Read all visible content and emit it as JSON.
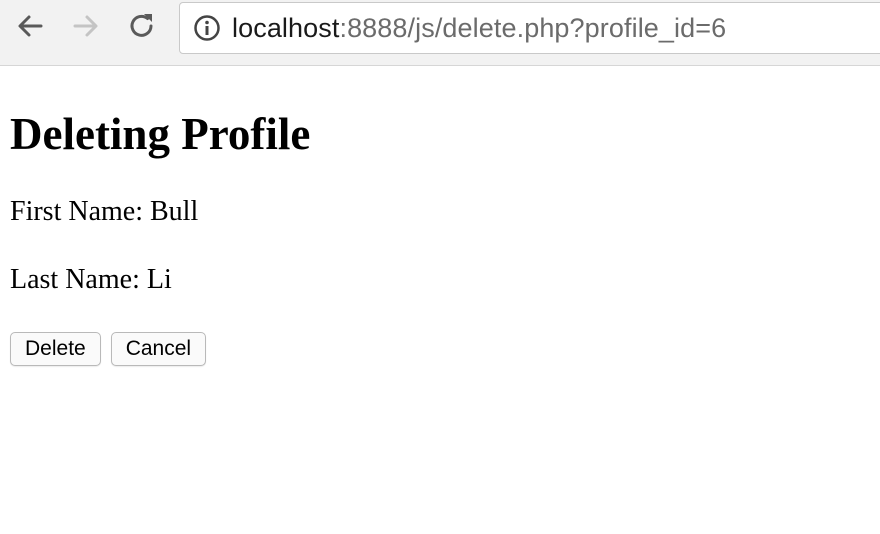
{
  "browser": {
    "url_host": "localhost",
    "url_rest": ":8888/js/delete.php?profile_id=6",
    "icons": {
      "back": "arrow-left",
      "forward": "arrow-right",
      "reload": "circular-arrow",
      "info": "circle-i"
    }
  },
  "page": {
    "title": "Deleting Profile",
    "first_name_label": "First Name: ",
    "first_name_value": "Bull",
    "last_name_label": "Last Name: ",
    "last_name_value": "Li",
    "delete_label": "Delete",
    "cancel_label": "Cancel"
  }
}
